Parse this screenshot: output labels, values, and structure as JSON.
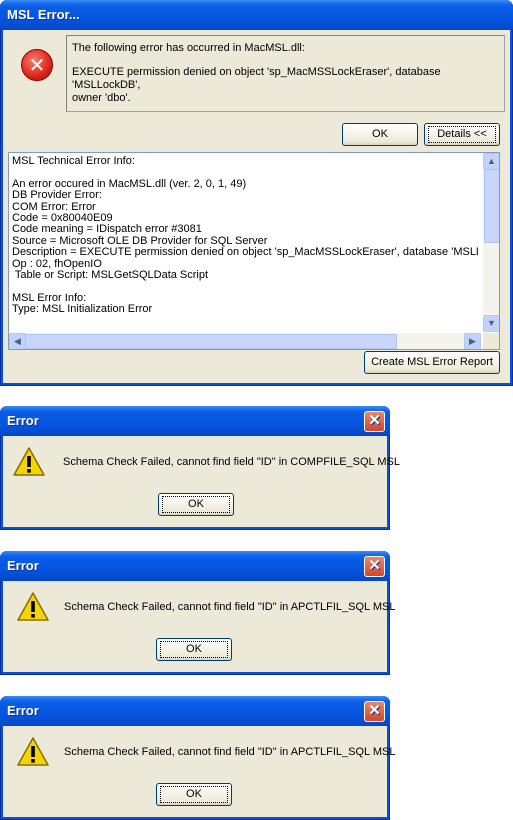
{
  "msl_error": {
    "title": "MSL Error...",
    "message_line1": "The following error has occurred in MacMSL.dll:",
    "message_line2": "EXECUTE permission denied on object 'sp_MacMSSLockEraser', database 'MSLLockDB',\nowner 'dbo'.",
    "ok_label": "OK",
    "details_label": "Details <<",
    "technical_info": [
      "MSL Technical Error Info:",
      "",
      "An error occured in MacMSL.dll (ver. 2, 0, 1, 49)",
      "DB Provider Error:",
      "COM Error: Error",
      "Code = 0x80040E09",
      "Code meaning = IDispatch error #3081",
      "Source = Microsoft OLE DB Provider for SQL Server",
      "Description = EXECUTE permission denied on object 'sp_MacMSSLockEraser', database 'MSLLoc",
      "Op : 02, fhOpenIO",
      " Table or Script: MSLGetSQLData Script",
      "",
      "MSL Error Info:",
      "Type: MSL Initialization Error"
    ],
    "create_report_label": "Create MSL Error Report"
  },
  "error_dialogs": [
    {
      "title": "Error",
      "message": "Schema Check Failed, cannot find field \"ID\" in COMPFILE_SQL MSL",
      "ok_label": "OK"
    },
    {
      "title": "Error",
      "message": "Schema Check Failed, cannot find field \"ID\" in APCTLFIL_SQL MSL",
      "ok_label": "OK"
    },
    {
      "title": "Error",
      "message": "Schema Check Failed, cannot find field \"ID\" in APCTLFIL_SQL MSL",
      "ok_label": "OK"
    }
  ],
  "icons": {
    "error": "error-x-icon",
    "warning": "warning-icon",
    "close": "close-icon",
    "scroll_up": "scroll-up-icon",
    "scroll_down": "scroll-down-icon",
    "scroll_left": "scroll-left-icon",
    "scroll_right": "scroll-right-icon"
  },
  "colors": {
    "title_bar": "#0a5ee8",
    "dialog_face": "#ece9d8",
    "close_button": "#d2472a",
    "error_icon": "#d8261a",
    "warning_icon": "#f5d400"
  }
}
